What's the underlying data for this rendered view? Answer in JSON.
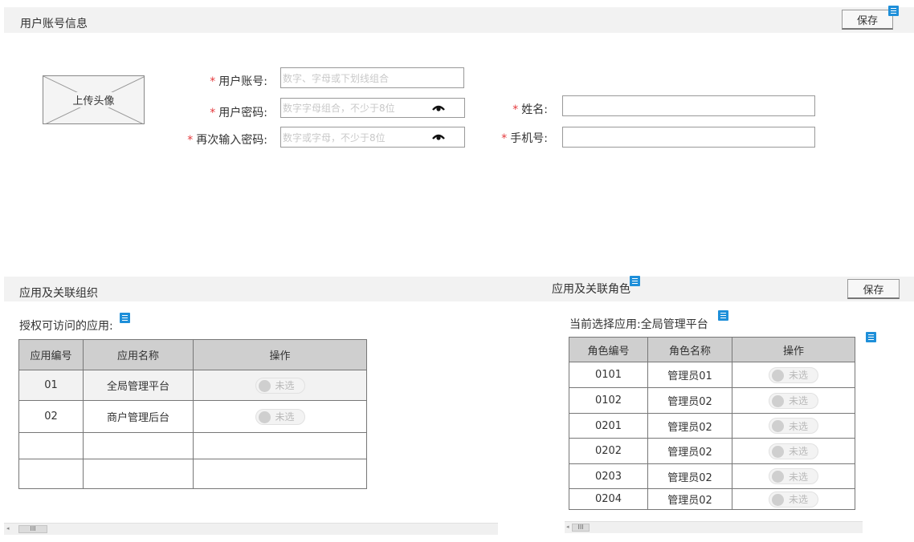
{
  "account_section": {
    "title": "用户账号信息",
    "save_label": "保存",
    "avatar_label": "上传头像",
    "required_mark": "*",
    "fields": {
      "username": {
        "label": "用户账号:",
        "placeholder": "数字、字母或下划线组合"
      },
      "password": {
        "label": "用户密码:",
        "placeholder": "数字字母组合，不少于8位"
      },
      "confirm_password": {
        "label": "再次输入密码:",
        "placeholder": "数字或字母，不少于8位"
      },
      "name": {
        "label": "姓名:",
        "value": ""
      },
      "phone": {
        "label": "手机号:",
        "value": ""
      }
    }
  },
  "app_section": {
    "title": "应用及关联组织",
    "subtitle": "授权可访问的应用:",
    "columns": [
      "应用编号",
      "应用名称",
      "操作"
    ],
    "rows": [
      {
        "id": "01",
        "name": "全局管理平台",
        "toggle": "未选"
      },
      {
        "id": "02",
        "name": "商户管理后台",
        "toggle": "未选"
      },
      {
        "id": "",
        "name": "",
        "toggle": ""
      },
      {
        "id": "",
        "name": "",
        "toggle": ""
      }
    ]
  },
  "role_section": {
    "title": "应用及关联角色",
    "save_label": "保存",
    "current_app_label": "当前选择应用:",
    "current_app_value": "全局管理平台",
    "columns": [
      "角色编号",
      "角色名称",
      "操作"
    ],
    "rows": [
      {
        "id": "0101",
        "name": "管理员01",
        "toggle": "未选"
      },
      {
        "id": "0102",
        "name": "管理员02",
        "toggle": "未选"
      },
      {
        "id": "0201",
        "name": "管理员02",
        "toggle": "未选"
      },
      {
        "id": "0202",
        "name": "管理员02",
        "toggle": "未选"
      },
      {
        "id": "0203",
        "name": "管理员02",
        "toggle": "未选"
      },
      {
        "id": "0204",
        "name": "管理员02",
        "toggle": "未选"
      }
    ]
  },
  "scrollbar_thumb_glyph": "III"
}
